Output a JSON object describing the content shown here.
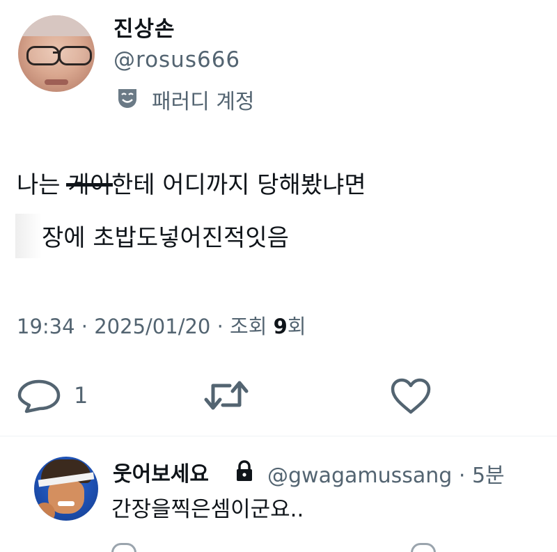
{
  "post": {
    "author_name": "진상손",
    "author_handle": "@rosus666",
    "account_label": "패러디 계정",
    "text_line1_prefix": "나는 ",
    "text_line1_struck": "게이",
    "text_line1_suffix": "한테 어디까지 당해봤냐면",
    "text_line2": "장에 초밥도넣어진적잇음",
    "time": "19:34",
    "date": "2025/01/20",
    "views_label": "조회",
    "views_count": "9",
    "views_suffix": "회",
    "separator": "·",
    "reply_count": "1"
  },
  "reply": {
    "author_name": "웃어보세요",
    "author_handle": "@gwagamussang",
    "separator": "·",
    "age": "5분",
    "text": "간장을찍은셈이군요.."
  },
  "icons": {
    "parody": "parody-mask-icon",
    "reply": "reply-bubble-icon",
    "retweet": "retweet-icon",
    "like": "heart-icon",
    "lock": "lock-icon"
  },
  "colors": {
    "text_primary": "#0f1419",
    "text_secondary": "#536471",
    "icon": "#536471"
  }
}
